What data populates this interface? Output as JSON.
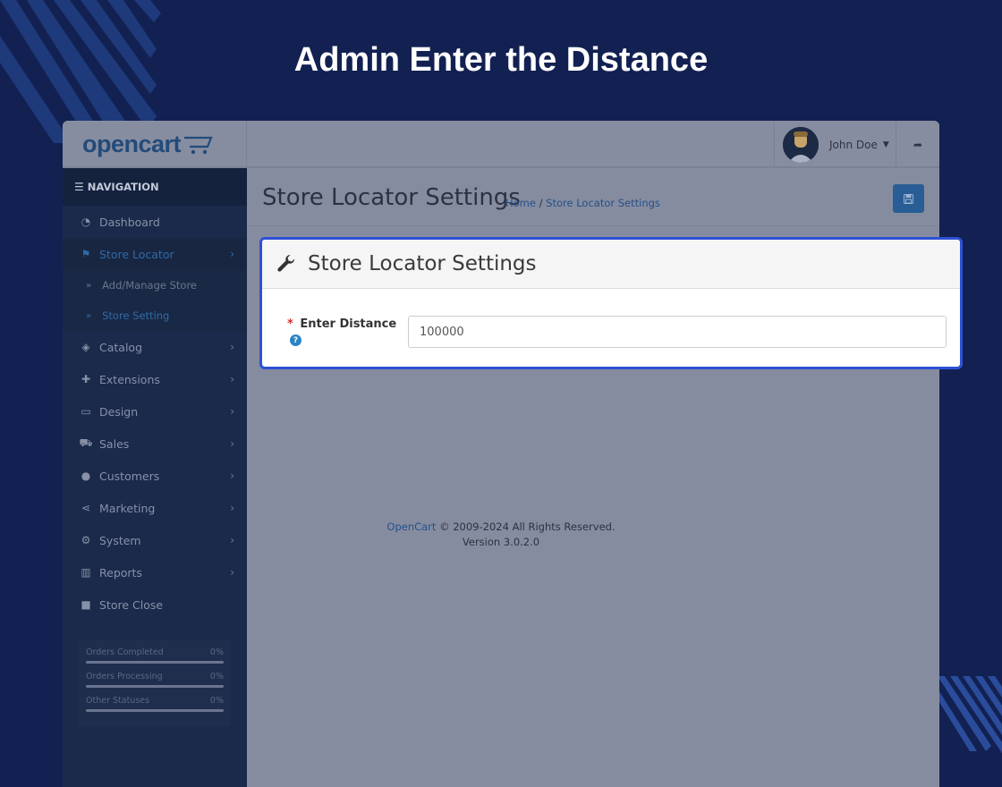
{
  "headline": "Admin Enter the Distance",
  "topbar": {
    "logo": "opencart",
    "user_name": "John Doe"
  },
  "sidebar": {
    "heading": "NAVIGATION",
    "items": [
      {
        "label": "Dashboard",
        "icon": "dashboard-icon"
      },
      {
        "label": "Store Locator",
        "icon": "flag-icon",
        "active": true
      },
      {
        "label": "Catalog",
        "icon": "tags-icon"
      },
      {
        "label": "Extensions",
        "icon": "puzzle-icon"
      },
      {
        "label": "Design",
        "icon": "monitor-icon"
      },
      {
        "label": "Sales",
        "icon": "cart-icon"
      },
      {
        "label": "Customers",
        "icon": "user-icon"
      },
      {
        "label": "Marketing",
        "icon": "share-icon"
      },
      {
        "label": "System",
        "icon": "gear-icon"
      },
      {
        "label": "Reports",
        "icon": "bar-chart-icon"
      },
      {
        "label": "Store Close",
        "icon": "lock-icon"
      }
    ],
    "sub_items": [
      {
        "label": "Add/Manage Store"
      },
      {
        "label": "Store Setting"
      }
    ],
    "stats": [
      {
        "label": "Orders Completed",
        "value": "0%"
      },
      {
        "label": "Orders Processing",
        "value": "0%"
      },
      {
        "label": "Other Statuses",
        "value": "0%"
      }
    ]
  },
  "content": {
    "page_title": "Store Locator Settings",
    "breadcrumb_home": "Home",
    "breadcrumb_sep": "/",
    "breadcrumb_current": "Store Locator Settings",
    "footer_link": "OpenCart",
    "footer_text": "© 2009-2024 All Rights Reserved.",
    "footer_version": "Version 3.0.2.0"
  },
  "panel": {
    "title": "Store Locator Settings",
    "field_required_mark": "*",
    "field_label": "Enter Distance",
    "field_help": "?",
    "field_value": "100000"
  },
  "colors": {
    "background": "#122152",
    "highlight_border": "#2d51d6",
    "accent": "#2f6aa8"
  }
}
